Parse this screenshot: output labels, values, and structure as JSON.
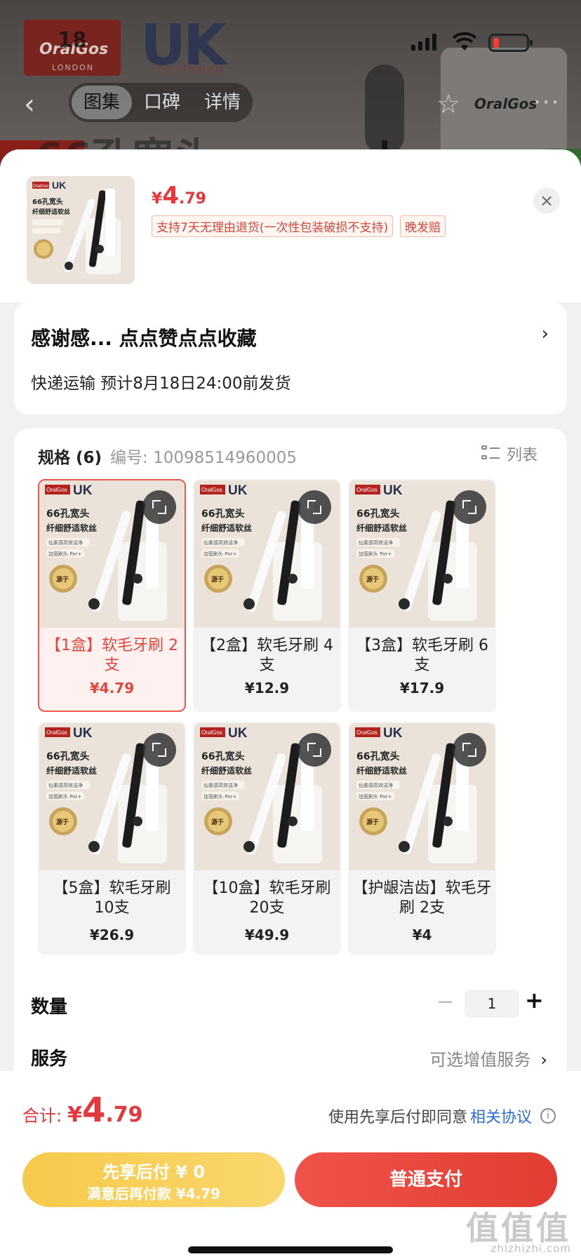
{
  "background": {
    "brand_text": "OralGos",
    "brand_sub": "LONDON",
    "uk": "UK",
    "designed": "- DESIGNED -",
    "headline": "66孔宽头",
    "card_text": "OralGos"
  },
  "status_bar": {
    "time": "18"
  },
  "nav": {
    "tabs": [
      "图集",
      "口碑",
      "详情"
    ],
    "back_icon": "back-chevron",
    "more": "···"
  },
  "product": {
    "price_symbol": "¥",
    "price_int": "4",
    "price_dec": ".79",
    "tags": [
      "支持7天无理由退货(一次性包装破损不支持)",
      "晚发赔"
    ],
    "close_glyph": "×"
  },
  "shipping": {
    "title": "感谢感... 点点赞点点收藏",
    "arrow": "›",
    "subtitle": "快递运输 预计8月18日24:00前发货"
  },
  "spec": {
    "label": "规格 (6)",
    "number": "编号: 10098514960005",
    "list_label": "列表",
    "items": [
      {
        "name": "【1盒】软毛牙刷 2支",
        "price": "¥4.79",
        "selected": true
      },
      {
        "name": "【2盒】软毛牙刷 4支",
        "price": "¥12.9"
      },
      {
        "name": "【3盒】软毛牙刷 6支",
        "price": "¥17.9"
      },
      {
        "name": "【5盒】软毛牙刷 10支",
        "price": "¥26.9"
      },
      {
        "name": "【10盒】软毛牙刷 20支",
        "price": "¥49.9"
      },
      {
        "name": "【护龈洁齿】软毛牙刷 2支",
        "price": "¥4"
      }
    ],
    "product_image_text": {
      "brand": "OralGos",
      "uk": "UK",
      "headline1": "66孔宽头",
      "headline2": "纤细舒适软丝",
      "line1": "仙素感高效洁净",
      "line2": "加宽刷头 Por+",
      "badge": "源于英国"
    }
  },
  "quantity": {
    "label": "数量",
    "minus": "−",
    "value": "1",
    "plus": "+"
  },
  "service": {
    "label": "服务",
    "value": "可选增值服务",
    "arrow": "›"
  },
  "footer": {
    "total_label": "合计:",
    "total_symbol": "¥",
    "total_int": "4",
    "total_dec": ".79",
    "agree_text": "使用先享后付即同意",
    "agree_link": "相关协议",
    "info_icon": "i",
    "credit_line1": "先享后付 ¥ 0",
    "credit_line2": "满意后再付款 ¥4.79",
    "pay_label": "普通支付"
  },
  "watermark": {
    "text": "值值值",
    "sub": "zhizhizhi.com"
  },
  "colors": {
    "accent": "#e4393c",
    "credit": "#f6c94a",
    "pay": "#e8443a",
    "link": "#2a6fd6"
  }
}
